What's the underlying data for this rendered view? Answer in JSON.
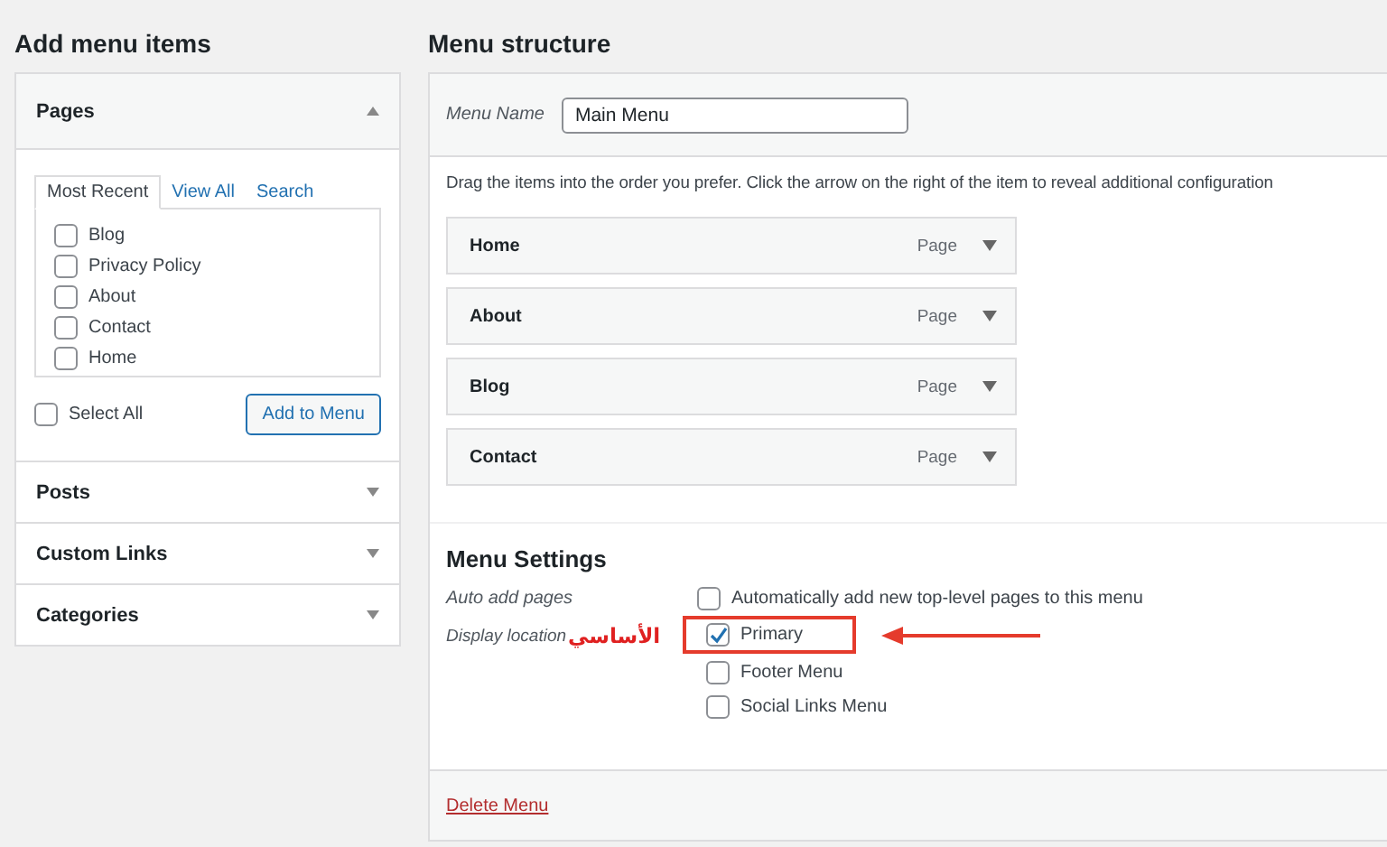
{
  "left": {
    "title": "Add menu items",
    "sections": [
      {
        "title": "Pages",
        "expanded": true
      },
      {
        "title": "Posts",
        "expanded": false
      },
      {
        "title": "Custom Links",
        "expanded": false
      },
      {
        "title": "Categories",
        "expanded": false
      }
    ],
    "tabs": [
      {
        "label": "Most Recent",
        "selected": true
      },
      {
        "label": "View All",
        "selected": false
      },
      {
        "label": "Search",
        "selected": false
      }
    ],
    "pages": [
      {
        "label": "Blog",
        "checked": false
      },
      {
        "label": "Privacy Policy",
        "checked": false
      },
      {
        "label": "About",
        "checked": false
      },
      {
        "label": "Contact",
        "checked": false
      },
      {
        "label": "Home",
        "checked": false
      }
    ],
    "select_all": {
      "label": "Select All",
      "checked": false
    },
    "add_button": "Add to Menu"
  },
  "right": {
    "title": "Menu structure",
    "menu_name_label": "Menu Name",
    "menu_name": "Main Menu",
    "description": "Drag the items into the order you prefer. Click the arrow on the right of the item to reveal additional configuration",
    "items": [
      {
        "label": "Home",
        "type": "Page"
      },
      {
        "label": "About",
        "type": "Page"
      },
      {
        "label": "Blog",
        "type": "Page"
      },
      {
        "label": "Contact",
        "type": "Page"
      }
    ],
    "settings_title": "Menu Settings",
    "auto_add": {
      "label": "Auto add pages",
      "option": {
        "label": "Automatically add new top-level pages to this menu",
        "checked": false
      }
    },
    "display_location": {
      "label": "Display location",
      "options": [
        {
          "label": "Primary",
          "checked": true
        },
        {
          "label": "Footer Menu",
          "checked": false
        },
        {
          "label": "Social Links Menu",
          "checked": false
        }
      ]
    },
    "annotation": "الأساسي",
    "delete_link": "Delete Menu"
  }
}
